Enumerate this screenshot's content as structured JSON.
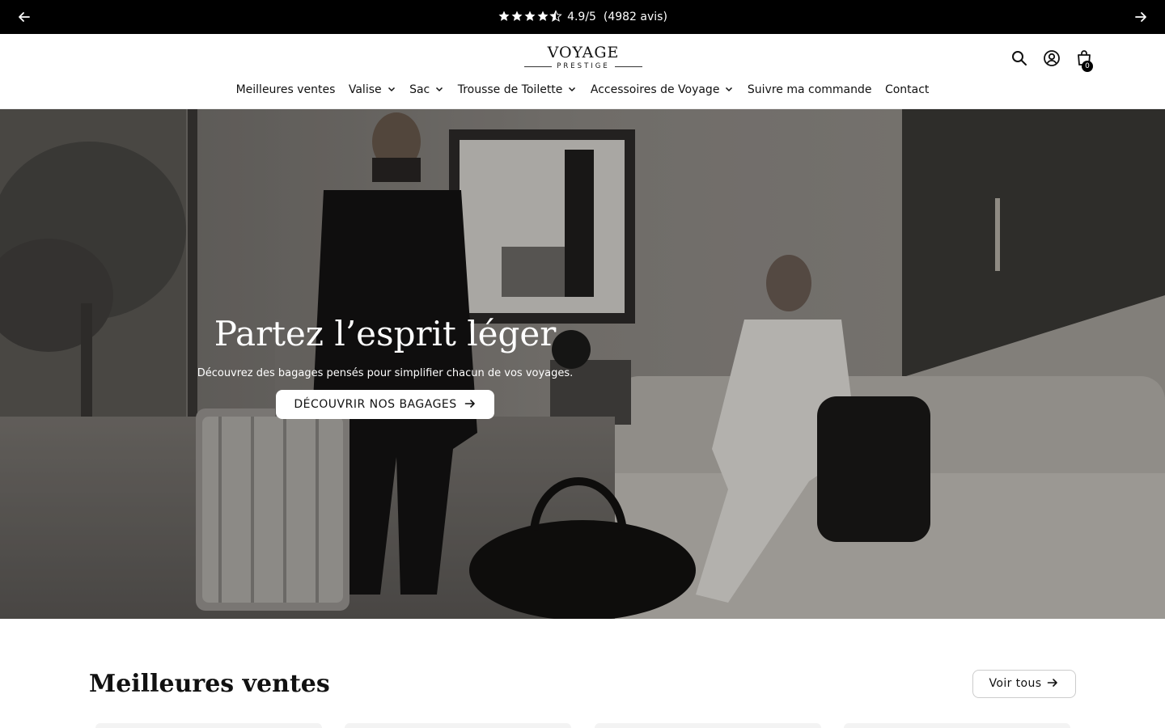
{
  "announcement": {
    "rating": "4.9/5",
    "reviews": "(4982 avis)",
    "stars": 4.5,
    "prev_icon": "arrow-left-icon",
    "next_icon": "arrow-right-icon"
  },
  "header": {
    "logo_main": "VOYAGE",
    "logo_sub": "PRESTIGE",
    "icons": [
      "search-icon",
      "account-icon",
      "cart-icon"
    ],
    "cart_count": "0"
  },
  "nav": {
    "items": [
      {
        "label": "Meilleures ventes",
        "dropdown": false
      },
      {
        "label": "Valise",
        "dropdown": true
      },
      {
        "label": "Sac",
        "dropdown": true
      },
      {
        "label": "Trousse de Toilette",
        "dropdown": true
      },
      {
        "label": "Accessoires de Voyage",
        "dropdown": true
      },
      {
        "label": "Suivre ma commande",
        "dropdown": false
      },
      {
        "label": "Contact",
        "dropdown": false
      }
    ]
  },
  "hero": {
    "title": "Partez l’esprit léger",
    "subtitle": "Découvrez des bagages pensés pour simplifier chacun de vos voyages.",
    "cta": "DÉCOUVRIR NOS BAGAGES"
  },
  "best_sellers": {
    "title": "Meilleures ventes",
    "see_all": "Voir tous"
  }
}
